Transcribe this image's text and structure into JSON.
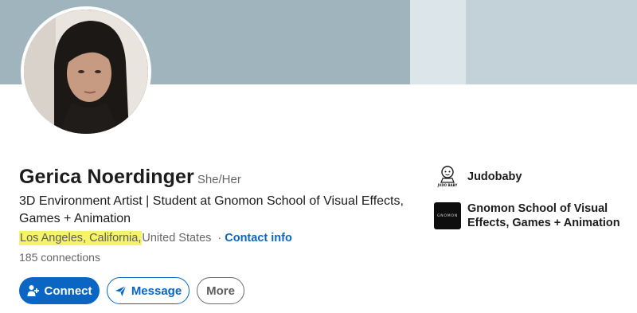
{
  "profile": {
    "name": "Gerica Noerdinger",
    "pronouns": "She/Her",
    "headline": "3D Environment Artist | Student at Gnomon School of Visual Effects, Games + Animation",
    "location_highlight": "Los Angeles, California,",
    "location_rest": " United States",
    "separator": "·",
    "contact_info": "Contact info",
    "connections": "185 connections"
  },
  "actions": {
    "connect": "Connect",
    "message": "Message",
    "more": "More"
  },
  "organizations": [
    {
      "name": "Judobaby",
      "logo_text": "JUDO BABY",
      "icon": "judobaby-logo"
    },
    {
      "name": "Gnomon School of Visual Effects, Games + Animation",
      "logo_text": "GNOMON",
      "icon": "gnomon-logo"
    }
  ],
  "colors": {
    "accent": "#0a66c2",
    "highlight": "#f5f36a",
    "banner": "#a0b4bd"
  }
}
